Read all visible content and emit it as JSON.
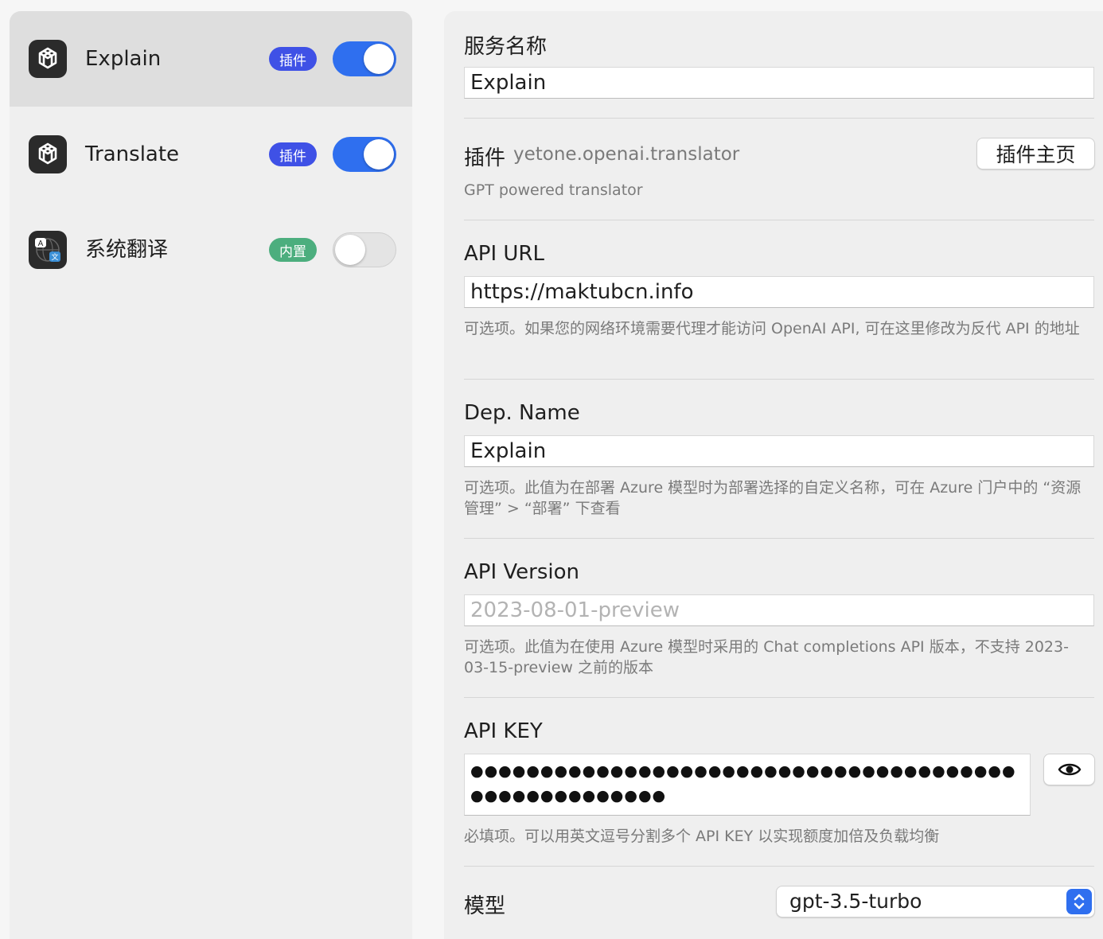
{
  "sidebar": {
    "services": [
      {
        "name": "Explain",
        "badge": "插件",
        "badge_color": "#3f51e6",
        "enabled": true,
        "icon": "openai-icon"
      },
      {
        "name": "Translate",
        "badge": "插件",
        "badge_color": "#3f51e6",
        "enabled": true,
        "icon": "openai-icon"
      },
      {
        "name": "系统翻译",
        "badge": "内置",
        "badge_color": "#4cae7e",
        "enabled": false,
        "icon": "translate-icon"
      }
    ]
  },
  "form": {
    "service_name_label": "服务名称",
    "service_name_value": "Explain",
    "plugin_label": "插件",
    "plugin_id": "yetone.openai.translator",
    "plugin_homepage_button": "插件主页",
    "plugin_desc": "GPT powered translator",
    "api_url_label": "API URL",
    "api_url_value": "https://maktubcn.info",
    "api_url_help": "可选项。如果您的网络环境需要代理才能访问 OpenAI API, 可在这里修改为反代 API 的地址",
    "dep_name_label": "Dep. Name",
    "dep_name_value": "Explain",
    "dep_name_help": "可选项。此值为在部署 Azure 模型时为部署选择的自定义名称，可在 Azure 门户中的 “资源管理” > “部署” 下查看",
    "api_version_label": "API Version",
    "api_version_placeholder": "2023-08-01-preview",
    "api_version_help": "可选项。此值为在使用 Azure 模型时采用的 Chat completions API 版本，不支持 2023-03-15-preview 之前的版本",
    "api_key_label": "API KEY",
    "api_key_masked": "●●●●●●●●●●●●●●●●●●●●●●●●●●●●●●●●●●●●●●●●●●●●●●●●●●●●●",
    "api_key_help": "必填项。可以用英文逗号分割多个 API KEY 以实现额度加倍及负载均衡",
    "model_label": "模型",
    "model_value": "gpt-3.5-turbo"
  },
  "colors": {
    "accent": "#2f6fef"
  }
}
